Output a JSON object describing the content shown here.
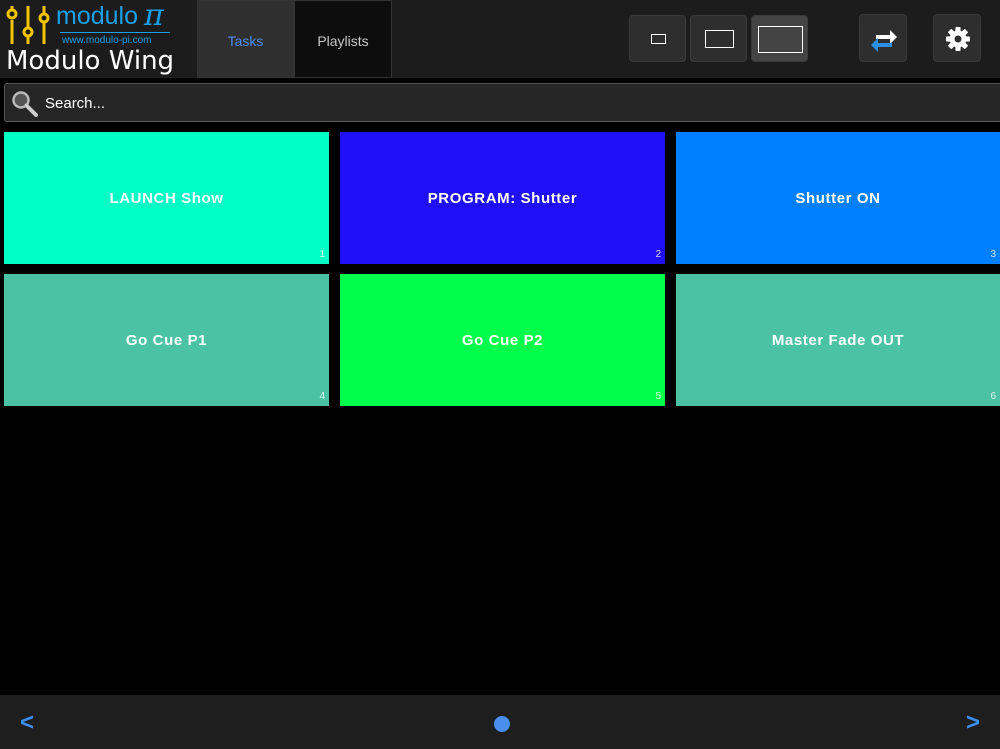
{
  "brand": {
    "name": "modulo",
    "pi_glyph": "π",
    "url": "www.modulo-pi.com",
    "app_title": "Modulo Wing",
    "color": "#1aa0e8"
  },
  "tabs": [
    {
      "label": "Tasks",
      "active": true
    },
    {
      "label": "Playlists",
      "active": false
    }
  ],
  "toolbar": {
    "tile_sizes": [
      {
        "name": "small",
        "selected": false
      },
      {
        "name": "medium",
        "selected": false
      },
      {
        "name": "large",
        "selected": true
      }
    ],
    "sync_icon": "sync-icon",
    "settings_icon": "gear-icon"
  },
  "search": {
    "placeholder": "Search..."
  },
  "tasks": [
    {
      "label": "LAUNCH Show",
      "number": "1",
      "color": "#00ffc4"
    },
    {
      "label": "PROGRAM: Shutter",
      "number": "2",
      "color": "#2010f5"
    },
    {
      "label": "Shutter ON",
      "number": "3",
      "color": "#0080ff"
    },
    {
      "label": "Go Cue P1",
      "number": "4",
      "color": "#4cc2a4"
    },
    {
      "label": "Go Cue P2",
      "number": "5",
      "color": "#00ff4a"
    },
    {
      "label": "Master Fade OUT",
      "number": "6",
      "color": "#4cc2a4"
    }
  ],
  "pager": {
    "prev": "<",
    "next": ">",
    "current_page": 1,
    "page_count": 1
  }
}
